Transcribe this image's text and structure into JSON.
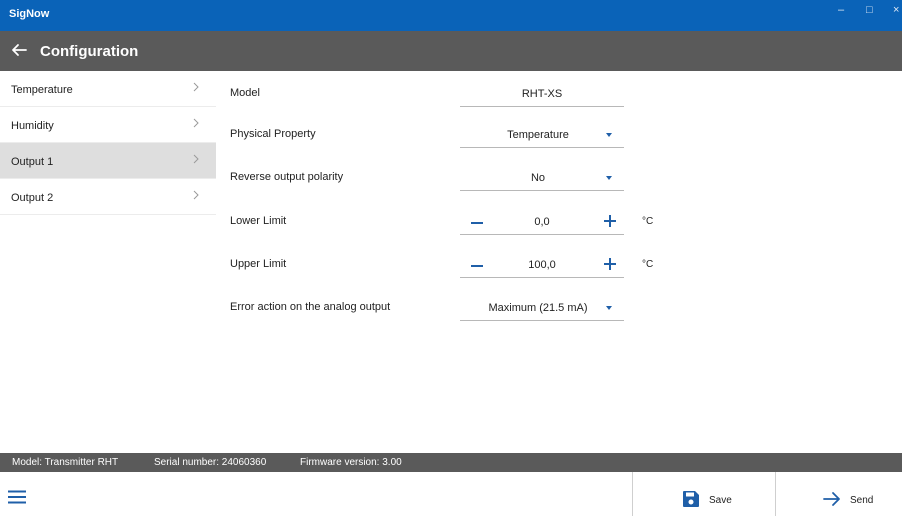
{
  "window": {
    "app_name": "SigNow",
    "minimize_glyph": "–",
    "maximize_glyph": "□",
    "close_glyph": "×"
  },
  "header": {
    "title": "Configuration",
    "back_icon": "arrow-left-icon"
  },
  "sidebar": {
    "items": [
      {
        "label": "Temperature",
        "active": false
      },
      {
        "label": "Humidity",
        "active": false
      },
      {
        "label": "Output 1",
        "active": true
      },
      {
        "label": "Output 2",
        "active": false
      }
    ],
    "chevron_icon": "chevron-right-icon"
  },
  "form": {
    "model": {
      "label": "Model",
      "value": "RHT-XS"
    },
    "physical_property": {
      "label": "Physical Property",
      "value": "Temperature"
    },
    "reverse_polarity": {
      "label": "Reverse output polarity",
      "value": "No"
    },
    "lower_limit": {
      "label": "Lower Limit",
      "value": "0,0",
      "unit": "°C"
    },
    "upper_limit": {
      "label": "Upper Limit",
      "value": "100,0",
      "unit": "°C"
    },
    "error_action": {
      "label": "Error action on the analog output",
      "value": "Maximum (21.5 mA)"
    }
  },
  "status": {
    "model": "Model: Transmitter RHT",
    "serial": "Serial number: 24060360",
    "firmware": "Firmware version: 3.00"
  },
  "actions": {
    "save_label": "Save",
    "send_label": "Send"
  },
  "colors": {
    "accent": "#0a63b8",
    "header": "#5a5a5a",
    "icon_blue": "#1f5fa8",
    "active_item": "#dedede"
  }
}
